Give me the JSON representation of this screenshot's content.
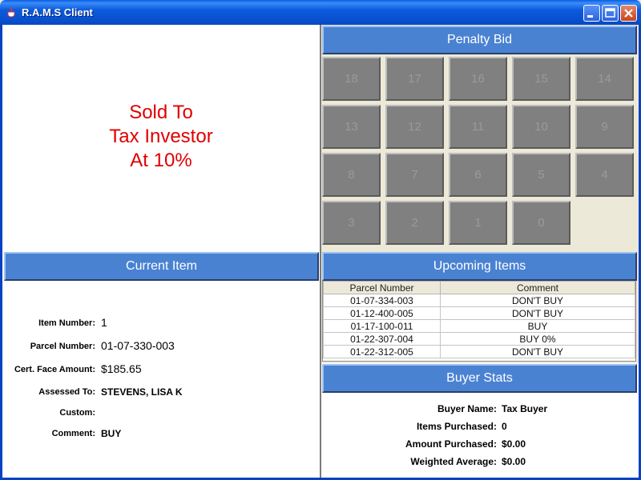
{
  "window": {
    "title": "R.A.M.S Client"
  },
  "sold_message": {
    "lines": [
      "Sold To",
      "Tax Investor",
      "At 10%"
    ],
    "color": "#e00000"
  },
  "penalty_bid": {
    "header": "Penalty Bid",
    "buttons": [
      "18",
      "17",
      "16",
      "15",
      "14",
      "13",
      "12",
      "11",
      "10",
      "9",
      "8",
      "7",
      "6",
      "5",
      "4",
      "3",
      "2",
      "1",
      "0"
    ]
  },
  "current_item": {
    "header": "Current Item",
    "fields": [
      {
        "label": "Item Number:",
        "value": "1"
      },
      {
        "label": "Parcel Number:",
        "value": "01-07-330-003"
      },
      {
        "label": "Cert. Face Amount:",
        "value": "$185.65"
      },
      {
        "label": "Assessed To:",
        "value": "STEVENS, LISA K"
      },
      {
        "label": "Custom:",
        "value": ""
      },
      {
        "label": "Comment:",
        "value": "BUY"
      }
    ]
  },
  "upcoming_items": {
    "header": "Upcoming Items",
    "columns": [
      "Parcel Number",
      "Comment"
    ],
    "rows": [
      [
        "01-07-334-003",
        "DON'T BUY"
      ],
      [
        "01-12-400-005",
        "DON'T BUY"
      ],
      [
        "01-17-100-011",
        "BUY"
      ],
      [
        "01-22-307-004",
        "BUY 0%"
      ],
      [
        "01-22-312-005",
        "DON'T BUY"
      ]
    ]
  },
  "buyer_stats": {
    "header": "Buyer Stats",
    "fields": [
      {
        "label": "Buyer Name:",
        "value": "Tax Buyer"
      },
      {
        "label": "Items Purchased:",
        "value": "0"
      },
      {
        "label": "Amount Purchased:",
        "value": "$0.00"
      },
      {
        "label": "Weighted Average:",
        "value": "$0.00"
      }
    ]
  },
  "colors": {
    "header_bg": "#4a82d2",
    "bid_button_bg": "#808080"
  }
}
